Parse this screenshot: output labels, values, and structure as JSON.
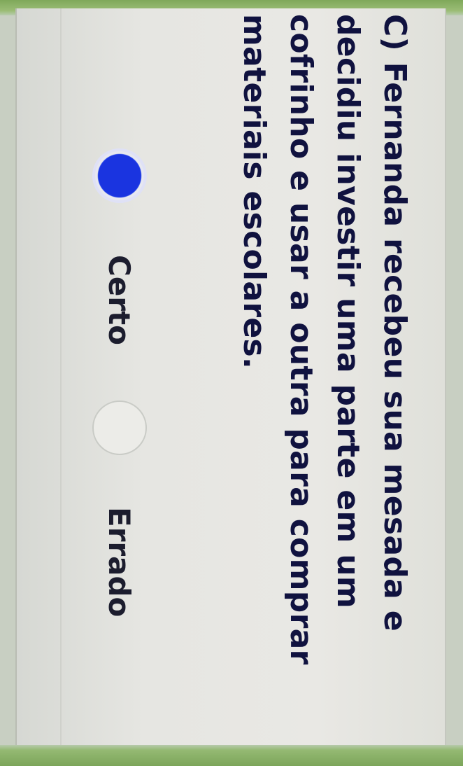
{
  "question": {
    "text": "C) Fernanda recebeu sua mesada e decidiu investir uma parte em um cofrinho e usar a outra para comprar materiais escolares."
  },
  "options": [
    {
      "label": "Certo",
      "selected": true
    },
    {
      "label": "Errado",
      "selected": false
    }
  ],
  "colors": {
    "selected_radio": "#1a34e0",
    "accent_green": "#8db566",
    "text": "#10123f"
  }
}
